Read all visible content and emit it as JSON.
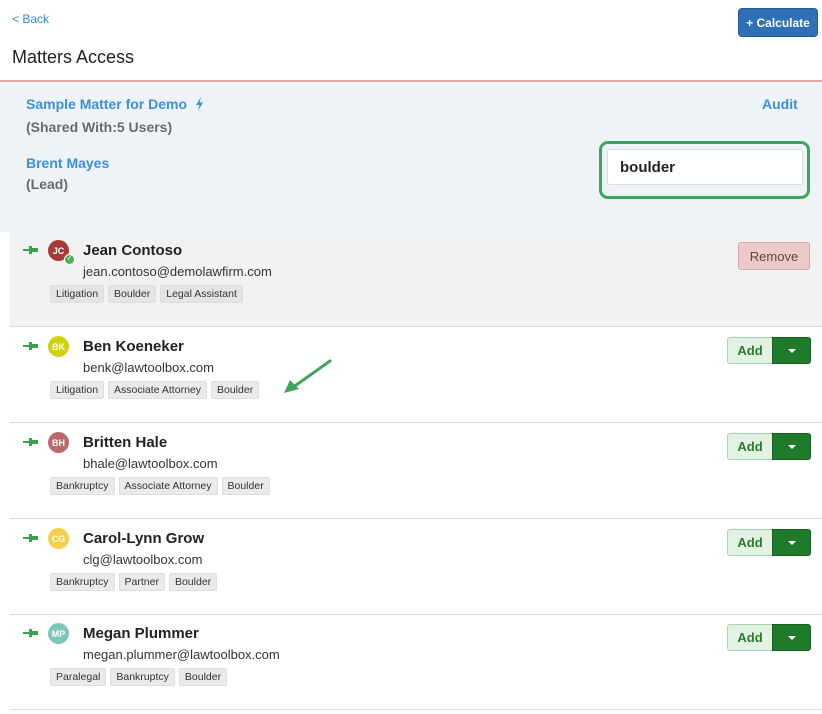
{
  "header": {
    "back_label": "< Back",
    "title": "Matters Access",
    "calculate_label": "+ Calculate"
  },
  "matter": {
    "name": "Sample Matter for Demo",
    "shared_with": "(Shared With:5 Users)",
    "lead_name": "Brent Mayes",
    "lead_role": "(Lead)",
    "audit_label": "Audit"
  },
  "search": {
    "value": "boulder"
  },
  "colors": {
    "link_blue": "#3b8fdc",
    "calculate_blue": "#2e6fb6",
    "add_green": "#1f7a2a",
    "highlight_green": "#3ea55b",
    "remove_red_bg": "#eccaca"
  },
  "users": [
    {
      "initials": "JC",
      "avatar_color": "#a83a35",
      "name": "Jean Contoso",
      "email": "jean.contoso@demolawfirm.com",
      "tags": [
        "Litigation",
        "Boulder",
        "Legal Assistant"
      ],
      "action": "Remove",
      "verified": true
    },
    {
      "initials": "BK",
      "avatar_color": "#cfd10a",
      "name": "Ben Koeneker",
      "email": "benk@lawtoolbox.com",
      "tags": [
        "Litigation",
        "Associate Attorney",
        "Boulder"
      ],
      "action": "Add"
    },
    {
      "initials": "BH",
      "avatar_color": "#b86a6a",
      "name": "Britten Hale",
      "email": "bhale@lawtoolbox.com",
      "tags": [
        "Bankruptcy",
        "Associate Attorney",
        "Boulder"
      ],
      "action": "Add"
    },
    {
      "initials": "CG",
      "avatar_color": "#f3cf4a",
      "name": "Carol-Lynn Grow",
      "email": "clg@lawtoolbox.com",
      "tags": [
        "Bankruptcy",
        "Partner",
        "Boulder"
      ],
      "action": "Add"
    },
    {
      "initials": "MP",
      "avatar_color": "#7cc7b8",
      "name": "Megan Plummer",
      "email": "megan.plummer@lawtoolbox.com",
      "tags": [
        "Paralegal",
        "Bankruptcy",
        "Boulder"
      ],
      "action": "Add"
    }
  ]
}
